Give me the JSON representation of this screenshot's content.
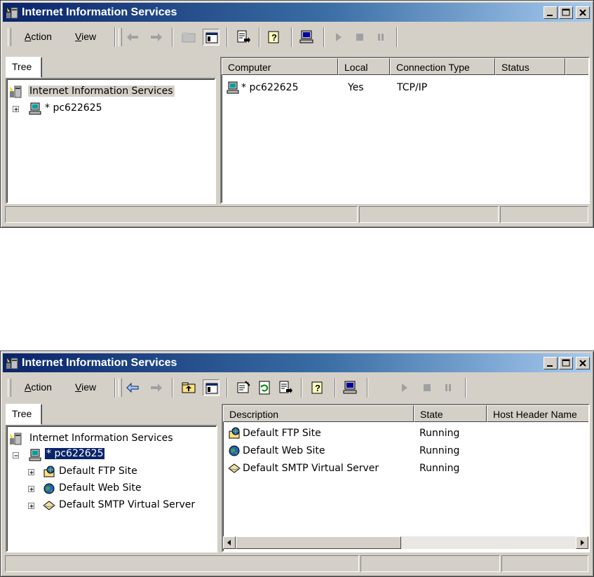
{
  "window_title": "Internet Information Services",
  "menu": {
    "action": "Action",
    "view": "View"
  },
  "tree_tab": "Tree",
  "top": {
    "tree": {
      "root": "Internet Information Services",
      "computer": "* pc622625"
    },
    "columns": [
      "Computer",
      "Local",
      "Connection Type",
      "Status"
    ],
    "rows": [
      {
        "computer": "* pc622625",
        "local": "Yes",
        "connection_type": "TCP/IP",
        "status": ""
      }
    ]
  },
  "bottom": {
    "tree": {
      "root": "Internet Information Services",
      "computer": "* pc622625",
      "children": [
        "Default FTP Site",
        "Default Web Site",
        "Default SMTP Virtual Server"
      ]
    },
    "columns": [
      "Description",
      "State",
      "Host Header Name"
    ],
    "rows": [
      {
        "description": "Default FTP Site",
        "state": "Running",
        "icon": "ftp-site-icon"
      },
      {
        "description": "Default Web Site",
        "state": "Running",
        "icon": "web-site-icon"
      },
      {
        "description": "Default SMTP Virtual Server",
        "state": "Running",
        "icon": "smtp-server-icon"
      }
    ]
  },
  "colors": {
    "title_start": "#0a246a",
    "title_end": "#a6caf0",
    "face": "#d4d0c8",
    "selection": "#0a246a"
  }
}
